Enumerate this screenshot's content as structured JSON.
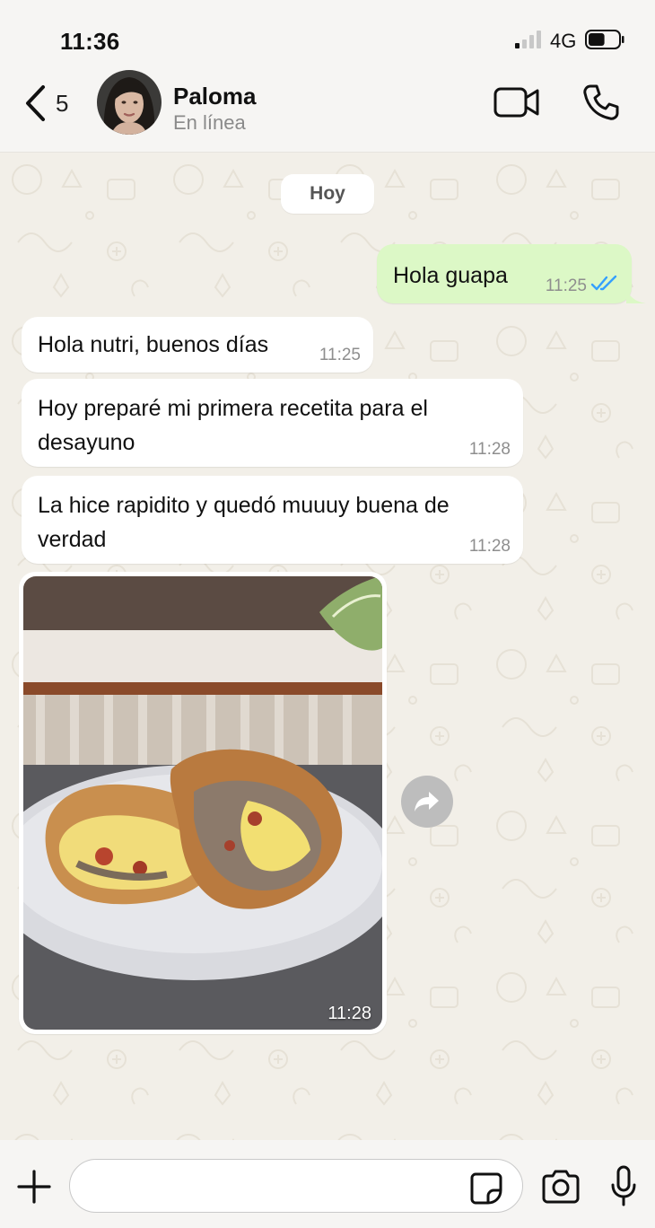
{
  "status_bar": {
    "time": "11:36",
    "network": "4G",
    "signal_bars_active": 1,
    "battery_level": 0.55
  },
  "header": {
    "back_count": "5",
    "contact_name": "Paloma",
    "contact_status": "En línea",
    "icons": [
      "chevron-left-icon",
      "video-camera-icon",
      "phone-icon"
    ]
  },
  "chat": {
    "date_chip": "Hoy",
    "messages": [
      {
        "direction": "out",
        "text": "Hola guapa",
        "time": "11:25",
        "status": "read"
      },
      {
        "direction": "in",
        "text": "Hola nutri, buenos días",
        "time": "11:25"
      },
      {
        "direction": "in",
        "text": "Hoy preparé mi primera recetita para el desayuno",
        "time": "11:28"
      },
      {
        "direction": "in",
        "text": "La hice rapidito y quedó muuuy buena de verdad",
        "time": "11:28"
      },
      {
        "direction": "in",
        "type": "image",
        "time": "11:28"
      }
    ]
  },
  "composer": {
    "input_value": "",
    "input_placeholder": "",
    "icons": [
      "plus-icon",
      "sticker-icon",
      "camera-icon",
      "microphone-icon"
    ]
  },
  "colors": {
    "outgoing_bubble": "#dcf8c6",
    "incoming_bubble": "#ffffff",
    "read_ticks": "#34a0ff",
    "chat_background": "#f2efe8"
  }
}
